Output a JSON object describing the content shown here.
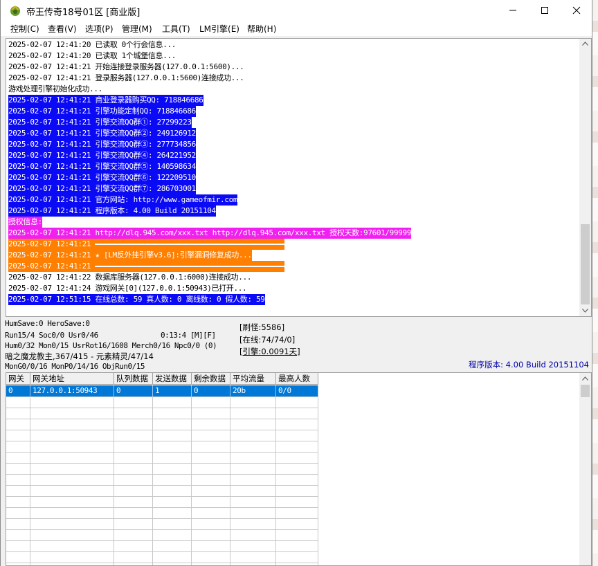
{
  "window": {
    "title": "帝王传奇18号01区 [商业版]",
    "minimize_icon": "minimize-icon",
    "maximize_icon": "maximize-icon",
    "close_icon": "close-icon"
  },
  "menu": [
    {
      "label": "控制(C)"
    },
    {
      "label": "查看(V)"
    },
    {
      "label": "选项(P)"
    },
    {
      "label": "管理(M)"
    },
    {
      "label": "工具(T)"
    },
    {
      "label": "LM引擎(E)"
    },
    {
      "label": "帮助(H)"
    }
  ],
  "log": {
    "lines": [
      {
        "text": "2025-02-07 12:41:20 已读取 0个行会信息...",
        "style": "normal"
      },
      {
        "text": "2025-02-07 12:41:20 已读取 1个城堡信息...",
        "style": "normal"
      },
      {
        "text": "2025-02-07 12:41:21 开始连接登录服务器(127.0.0.1:5600)...",
        "style": "normal"
      },
      {
        "text": "2025-02-07 12:41:21 登录服务器(127.0.0.1:5600)连接成功...",
        "style": "normal"
      },
      {
        "text": "游戏处理引擎初始化成功...",
        "style": "normal"
      },
      {
        "text": "2025-02-07 12:41:21 商业登录器购买QQ: 718846686",
        "style": "blue"
      },
      {
        "text": "2025-02-07 12:41:21 引擎功能定制QQ: 718846686",
        "style": "blue"
      },
      {
        "text": "2025-02-07 12:41:21 引擎交流QQ群①: 27299223",
        "style": "blue"
      },
      {
        "text": "2025-02-07 12:41:21 引擎交流QQ群②: 249126912",
        "style": "blue"
      },
      {
        "text": "2025-02-07 12:41:21 引擎交流QQ群③: 277734856",
        "style": "blue"
      },
      {
        "text": "2025-02-07 12:41:21 引擎交流QQ群④: 264221952",
        "style": "blue"
      },
      {
        "text": "2025-02-07 12:41:21 引擎交流QQ群⑤: 140598634",
        "style": "blue"
      },
      {
        "text": "2025-02-07 12:41:21 引擎交流QQ群⑥: 122209510",
        "style": "blue"
      },
      {
        "text": "2025-02-07 12:41:21 引擎交流QQ群⑦: 286703001",
        "style": "blue"
      },
      {
        "text": "2025-02-07 12:41:21 官方网站: http://www.gameofmir.com",
        "style": "blue"
      },
      {
        "text": "2025-02-07 12:41:21 程序版本: 4.00 Build 20151104",
        "style": "blue"
      },
      {
        "text": "授权信息:",
        "style": "magenta"
      },
      {
        "text": "2025-02-07 12:41:21 http://dlq.945.com/xxx.txt http://dlq.945.com/xxx.txt 授权天数:97601/99999",
        "style": "magenta"
      },
      {
        "text": "2025-02-07 12:41:21 ",
        "style": "orange-rule"
      },
      {
        "text": "2025-02-07 12:41:21 ★ [LM反外挂引擎v3.6]:引擎漏洞修复成功...",
        "style": "orange"
      },
      {
        "text": "2025-02-07 12:41:21 ",
        "style": "orange-rule"
      },
      {
        "text": "2025-02-07 12:41:22 数据库服务器(127.0.0.1:6000)连接成功...",
        "style": "normal"
      },
      {
        "text": "2025-02-07 12:41:24 游戏网关[0](127.0.0.1:50943)已打开...",
        "style": "normal"
      },
      {
        "text": "2025-02-07 12:51:15 在线总数: 59 真人数: 0 离线数: 0 假人数: 59",
        "style": "blue"
      }
    ]
  },
  "status": {
    "humsave": "HumSave:0 HeroSave:0",
    "run": "Run15/4 Soc0/0 Usr0/46",
    "time": "0:13:4 [M][F]",
    "hum": "Hum0/32 Mon0/15 UsrRot16/1608 Merch0/16 Npc0/0 (0)",
    "boss": "暗之魔龙教主,367/415 - 元素精灵/47/14",
    "mongo": "MonG0/0/16 MonP0/14/16 ObjRun0/15",
    "refresh": "[刷怪:5586]",
    "online": "[在线:74/74/0]",
    "engine": "[引擎:0.0091天]",
    "version": "程序版本: 4.00 Build 20151104"
  },
  "grid": {
    "headers": [
      "网关",
      "网关地址",
      "队列数据",
      "发送数据",
      "剩余数据",
      "平均流量",
      "最高人数"
    ],
    "rows": [
      [
        "0",
        "127.0.0.1:50943",
        "0",
        "1",
        "0",
        "20b",
        "0/0"
      ]
    ]
  }
}
